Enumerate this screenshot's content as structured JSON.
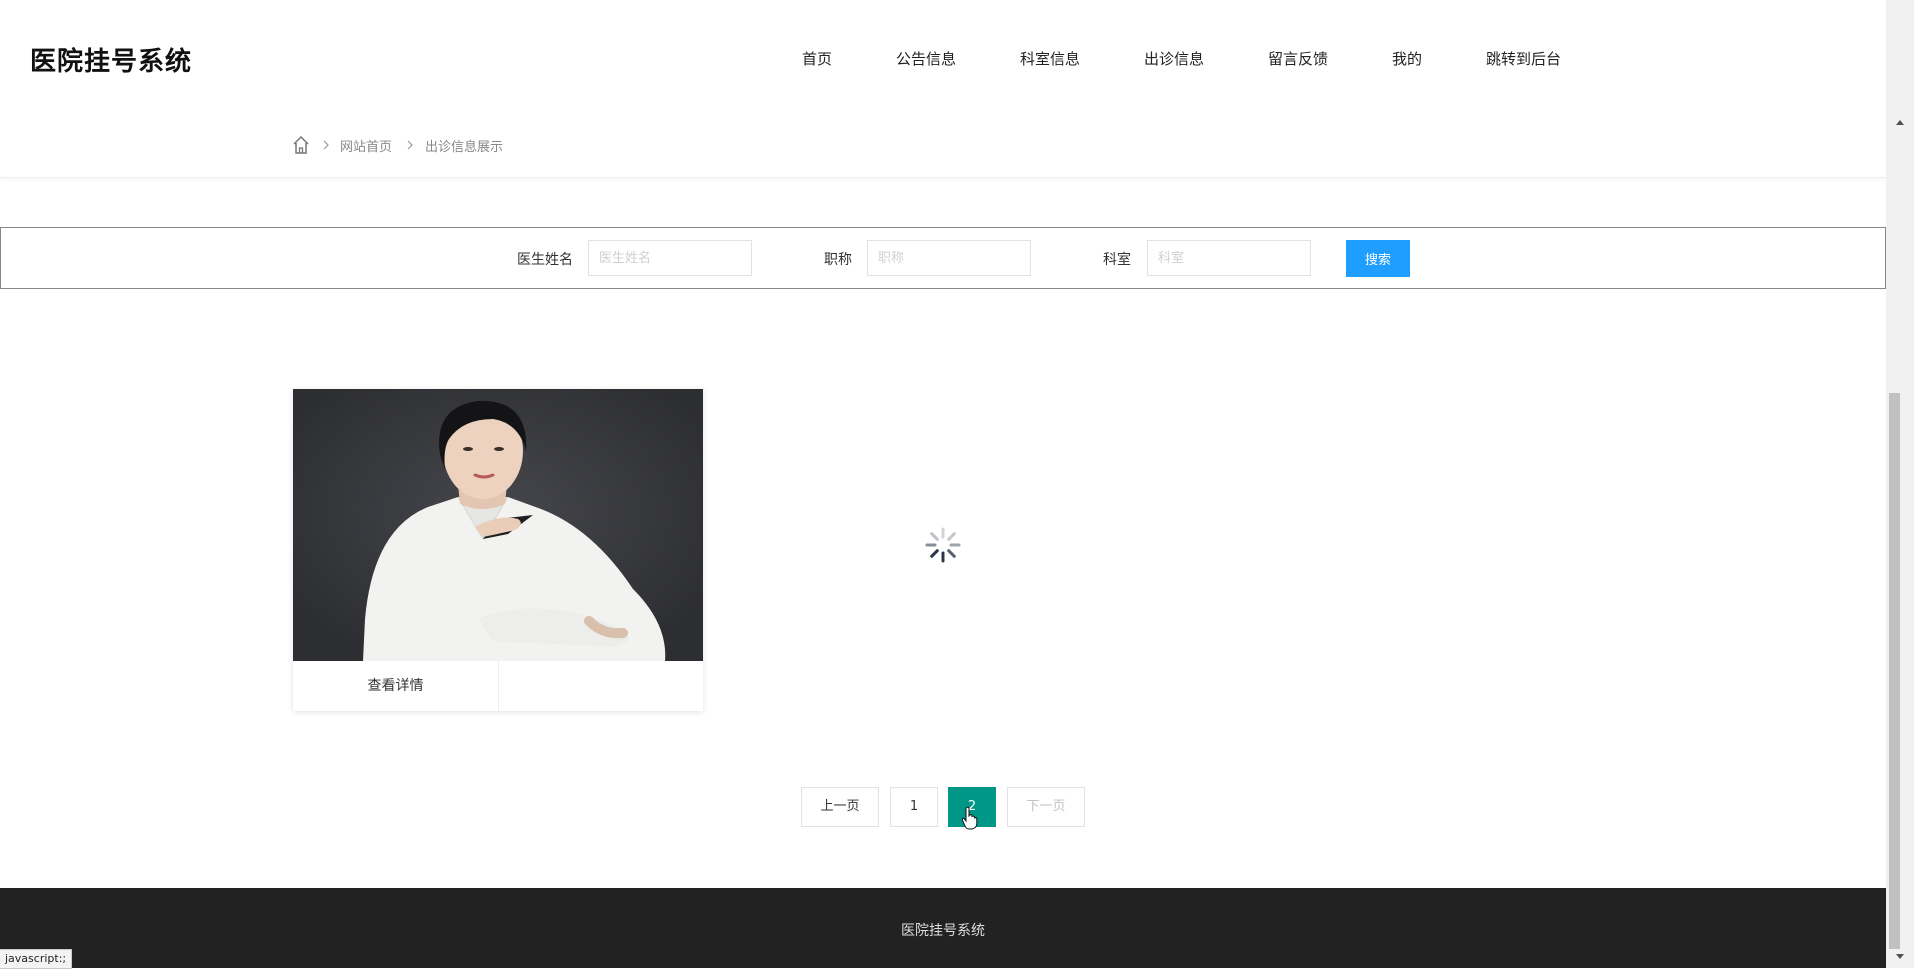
{
  "header": {
    "logo": "医院挂号系统",
    "nav": [
      "首页",
      "公告信息",
      "科室信息",
      "出诊信息",
      "留言反馈",
      "我的",
      "跳转到后台"
    ]
  },
  "breadcrumb": {
    "home_icon": "home-icon",
    "link": "网站首页",
    "current": "出诊信息展示"
  },
  "search": {
    "doctor_name_label": "医生姓名",
    "doctor_name_placeholder": "医生姓名",
    "title_label": "职称",
    "title_placeholder": "职称",
    "department_label": "科室",
    "department_placeholder": "科室",
    "button": "搜索"
  },
  "card": {
    "detail_label": "查看详情"
  },
  "pagination": {
    "prev": "上一页",
    "pages": [
      "1",
      "2"
    ],
    "current": "2",
    "next": "下一页"
  },
  "footer": {
    "text": "医院挂号系统"
  },
  "status_bar": {
    "text": "javascript:;"
  },
  "colors": {
    "search_button": "#1e9fff",
    "active_page": "#009688",
    "footer_bg": "#222222"
  }
}
